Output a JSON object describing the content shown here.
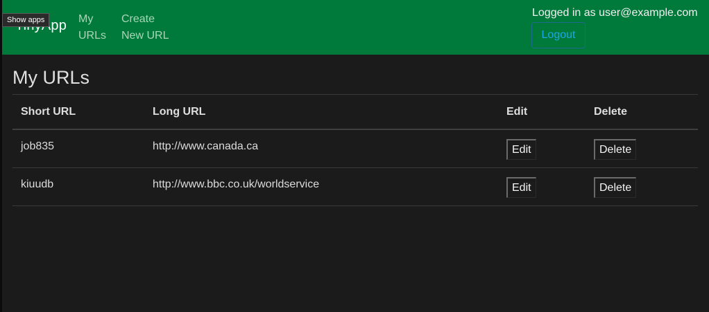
{
  "navbar": {
    "brand": "TinyApp",
    "my_urls": "My\nURLs",
    "create_new_url": "Create\nNew URL",
    "user_status": "Logged in as user@example.com",
    "logout_label": "Logout",
    "background_color": "#007a3a"
  },
  "tooltip": {
    "text": "Show apps"
  },
  "main": {
    "title": "My URLs",
    "columns": [
      "Short URL",
      "Long URL",
      "Edit",
      "Delete"
    ],
    "rows": [
      {
        "short_url": "job835",
        "long_url": "http://www.canada.ca",
        "edit_label": "Edit",
        "delete_label": "Delete"
      },
      {
        "short_url": "kiuudb",
        "long_url": "http://www.bbc.co.uk/worldservice",
        "edit_label": "Edit",
        "delete_label": "Delete"
      }
    ]
  }
}
